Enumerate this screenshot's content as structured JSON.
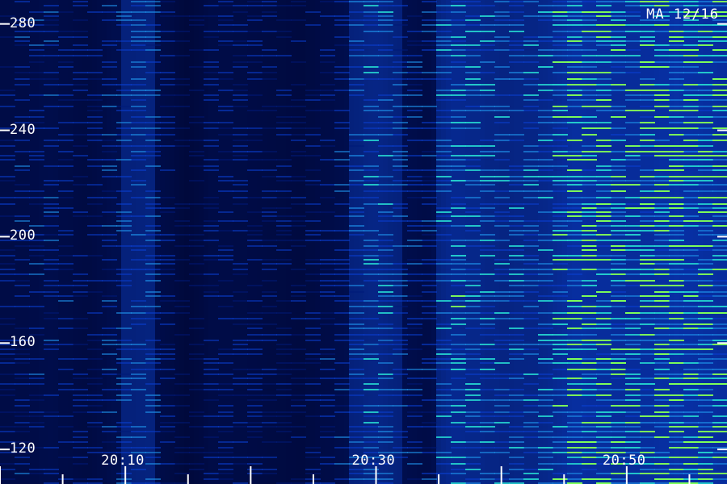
{
  "chart_data": {
    "type": "heatmap",
    "title": "MA 12/16",
    "yticks": [
      120,
      160,
      200,
      240,
      280
    ],
    "ylim": [
      107,
      289
    ],
    "xticks": [
      "20:10",
      "20:30",
      "20:50"
    ],
    "xlim": [
      "20:00",
      "20:58"
    ],
    "xminor_step_minutes": 5,
    "colormap": [
      "#00001c",
      "#001a7a",
      "#0a3fd0",
      "#1e8fe8",
      "#25d3d0",
      "#7dff5a"
    ],
    "intensity_profile": [
      {
        "t": "20:00",
        "level": 0.35
      },
      {
        "t": "20:04",
        "level": 0.45
      },
      {
        "t": "20:07",
        "level": 0.3
      },
      {
        "t": "20:09",
        "level": 0.48
      },
      {
        "t": "20:12",
        "level": 0.55
      },
      {
        "t": "20:15",
        "level": 0.15
      },
      {
        "t": "20:17",
        "level": 0.4
      },
      {
        "t": "20:20",
        "level": 0.35
      },
      {
        "t": "20:24",
        "level": 0.25
      },
      {
        "t": "20:27",
        "level": 0.45
      },
      {
        "t": "20:30",
        "level": 0.62
      },
      {
        "t": "20:34",
        "level": 0.38
      },
      {
        "t": "20:36",
        "level": 0.72
      },
      {
        "t": "20:40",
        "level": 0.58
      },
      {
        "t": "20:43",
        "level": 0.62
      },
      {
        "t": "20:46",
        "level": 0.88
      },
      {
        "t": "20:50",
        "level": 0.8
      },
      {
        "t": "20:54",
        "level": 0.92
      },
      {
        "t": "20:58",
        "level": 0.85
      }
    ]
  }
}
